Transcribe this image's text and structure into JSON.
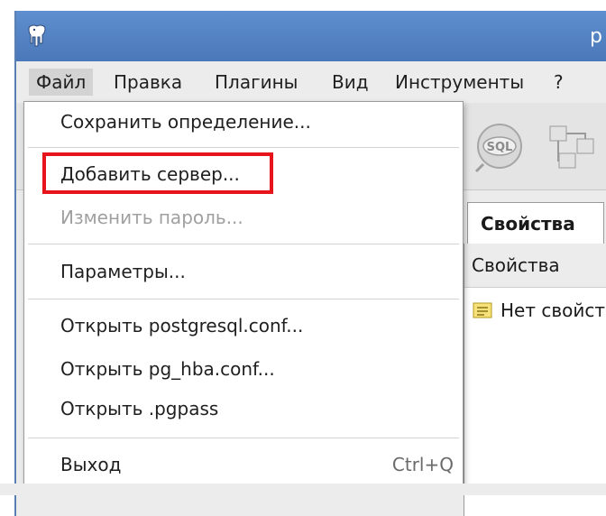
{
  "window": {
    "title": "p"
  },
  "menubar": {
    "items": [
      "Файл",
      "Правка",
      "Плагины",
      "Вид",
      "Инструменты",
      "?"
    ]
  },
  "file_menu": {
    "items": [
      {
        "label": "Сохранить определение...",
        "enabled": true
      },
      {
        "label": "Добавить сервер...",
        "enabled": true,
        "highlighted": true
      },
      {
        "label": "Изменить пароль...",
        "enabled": false
      },
      {
        "label": "Параметры...",
        "enabled": true
      },
      {
        "label": "Открыть postgresql.conf...",
        "enabled": true
      },
      {
        "label": "Открыть pg_hba.conf...",
        "enabled": true
      },
      {
        "label": "Открыть .pgpass",
        "enabled": true
      },
      {
        "label": "Выход",
        "enabled": true,
        "shortcut": "Ctrl+Q"
      }
    ]
  },
  "toolbar": {
    "icons": [
      "sql-icon",
      "query-tool-icon"
    ],
    "sql_text": "SQL"
  },
  "properties": {
    "tab_label": "Свойства",
    "header": "Свойства",
    "empty_text": "Нет свойст"
  },
  "colors": {
    "titlebar": "#4a78b8",
    "highlight": "#e8141c",
    "menu_active": "#d3d3d3",
    "disabled_text": "#a0a0a0"
  }
}
